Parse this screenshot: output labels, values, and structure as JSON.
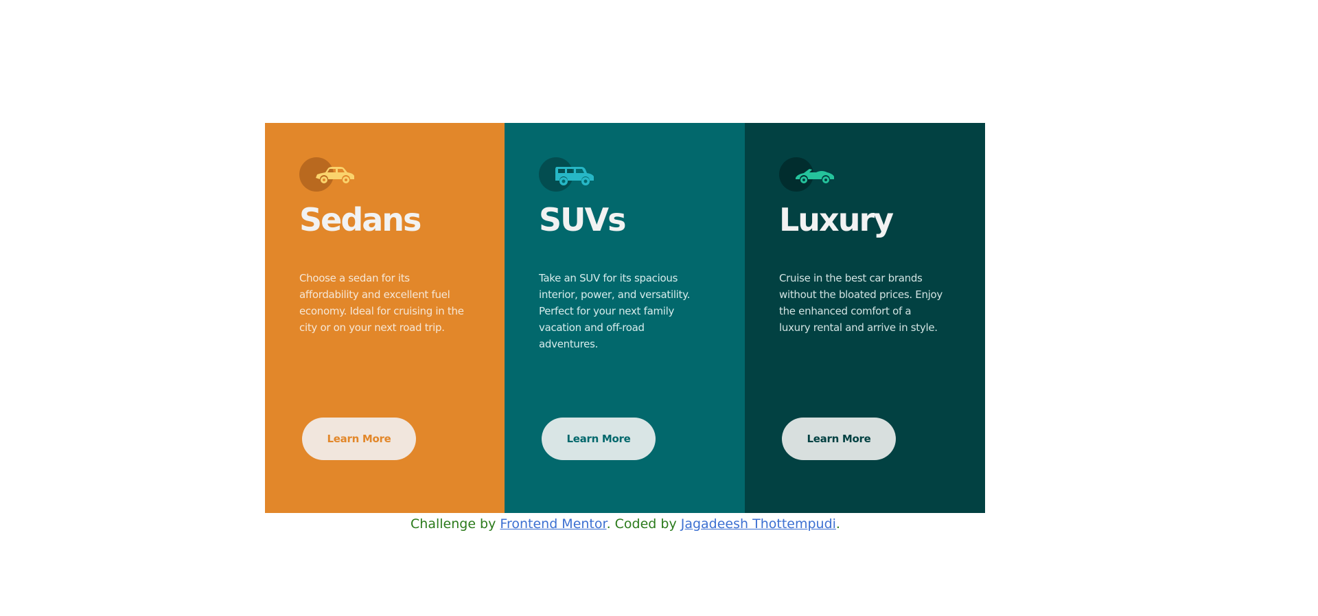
{
  "cards": [
    {
      "title": "Sedans",
      "description": "Choose a sedan for its affordability and excellent fuel economy. Ideal for cruising in the city or on your next road trip.",
      "button_label": "Learn More",
      "icon": "sedan-car-icon",
      "colors": {
        "background": "#e2872a",
        "icon_circle": "#b9691f",
        "icon": "#fad36d",
        "description": "#f6e7d6",
        "button_bg": "#f1e6dd",
        "button_text": "#e2872a"
      }
    },
    {
      "title": "SUVs",
      "description": "Take an SUV for its spacious interior, power, and versatility. Perfect for your next family vacation and off-road adventures.",
      "button_label": "Learn More",
      "icon": "suv-car-icon",
      "colors": {
        "background": "#02686c",
        "icon_circle": "#034d50",
        "icon": "#27b7c6",
        "description": "#d7ecec",
        "button_bg": "#d9e5e5",
        "button_text": "#02686c"
      }
    },
    {
      "title": "Luxury",
      "description": "Cruise in the best car brands without the bloated prices. Enjoy the enhanced comfort of a luxury rental and arrive in style.",
      "button_label": "Learn More",
      "icon": "luxury-car-icon",
      "colors": {
        "background": "#024142",
        "icon_circle": "#012d2e",
        "icon": "#25c39c",
        "description": "#d2e3e2",
        "button_bg": "#d8dfde",
        "button_text": "#024142"
      }
    }
  ],
  "attribution": {
    "prefix": "Challenge by ",
    "link1": "Frontend Mentor",
    "middle": ". Coded by ",
    "link2": "Jagadeesh Thottempudi",
    "suffix": "."
  }
}
